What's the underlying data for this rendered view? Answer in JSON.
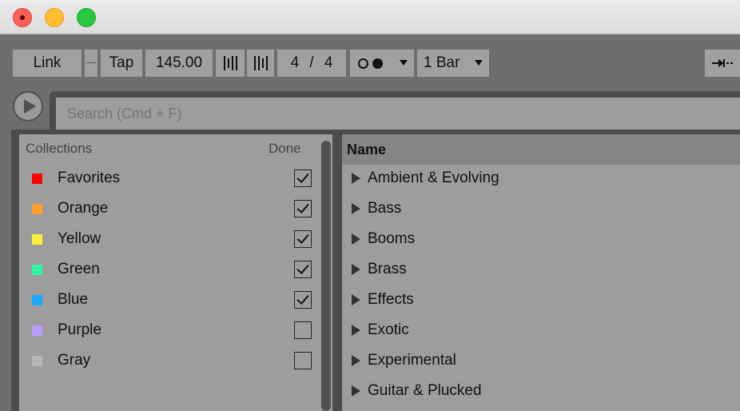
{
  "toolbar": {
    "link": "Link",
    "tap": "Tap",
    "tempo": "145.00",
    "sig_num": "4",
    "sig_sep": "/",
    "sig_den": "4",
    "quantize": "1 Bar",
    "follow_icon": "follow-arrow-icon"
  },
  "search": {
    "placeholder": "Search (Cmd + F)"
  },
  "collections": {
    "header": "Collections",
    "done": "Done",
    "items": [
      {
        "label": "Favorites",
        "color": "#ff0000",
        "checked": true
      },
      {
        "label": "Orange",
        "color": "#ff9f2e",
        "checked": true
      },
      {
        "label": "Yellow",
        "color": "#ffee3a",
        "checked": true
      },
      {
        "label": "Green",
        "color": "#2ef5a4",
        "checked": true
      },
      {
        "label": "Blue",
        "color": "#1aa8ff",
        "checked": true
      },
      {
        "label": "Purple",
        "color": "#bb99ff",
        "checked": false
      },
      {
        "label": "Gray",
        "color": "#b5b5b5",
        "checked": false
      }
    ]
  },
  "list": {
    "header": "Name",
    "items": [
      "Ambient & Evolving",
      "Bass",
      "Booms",
      "Brass",
      "Effects",
      "Exotic",
      "Experimental",
      "Guitar & Plucked"
    ]
  }
}
